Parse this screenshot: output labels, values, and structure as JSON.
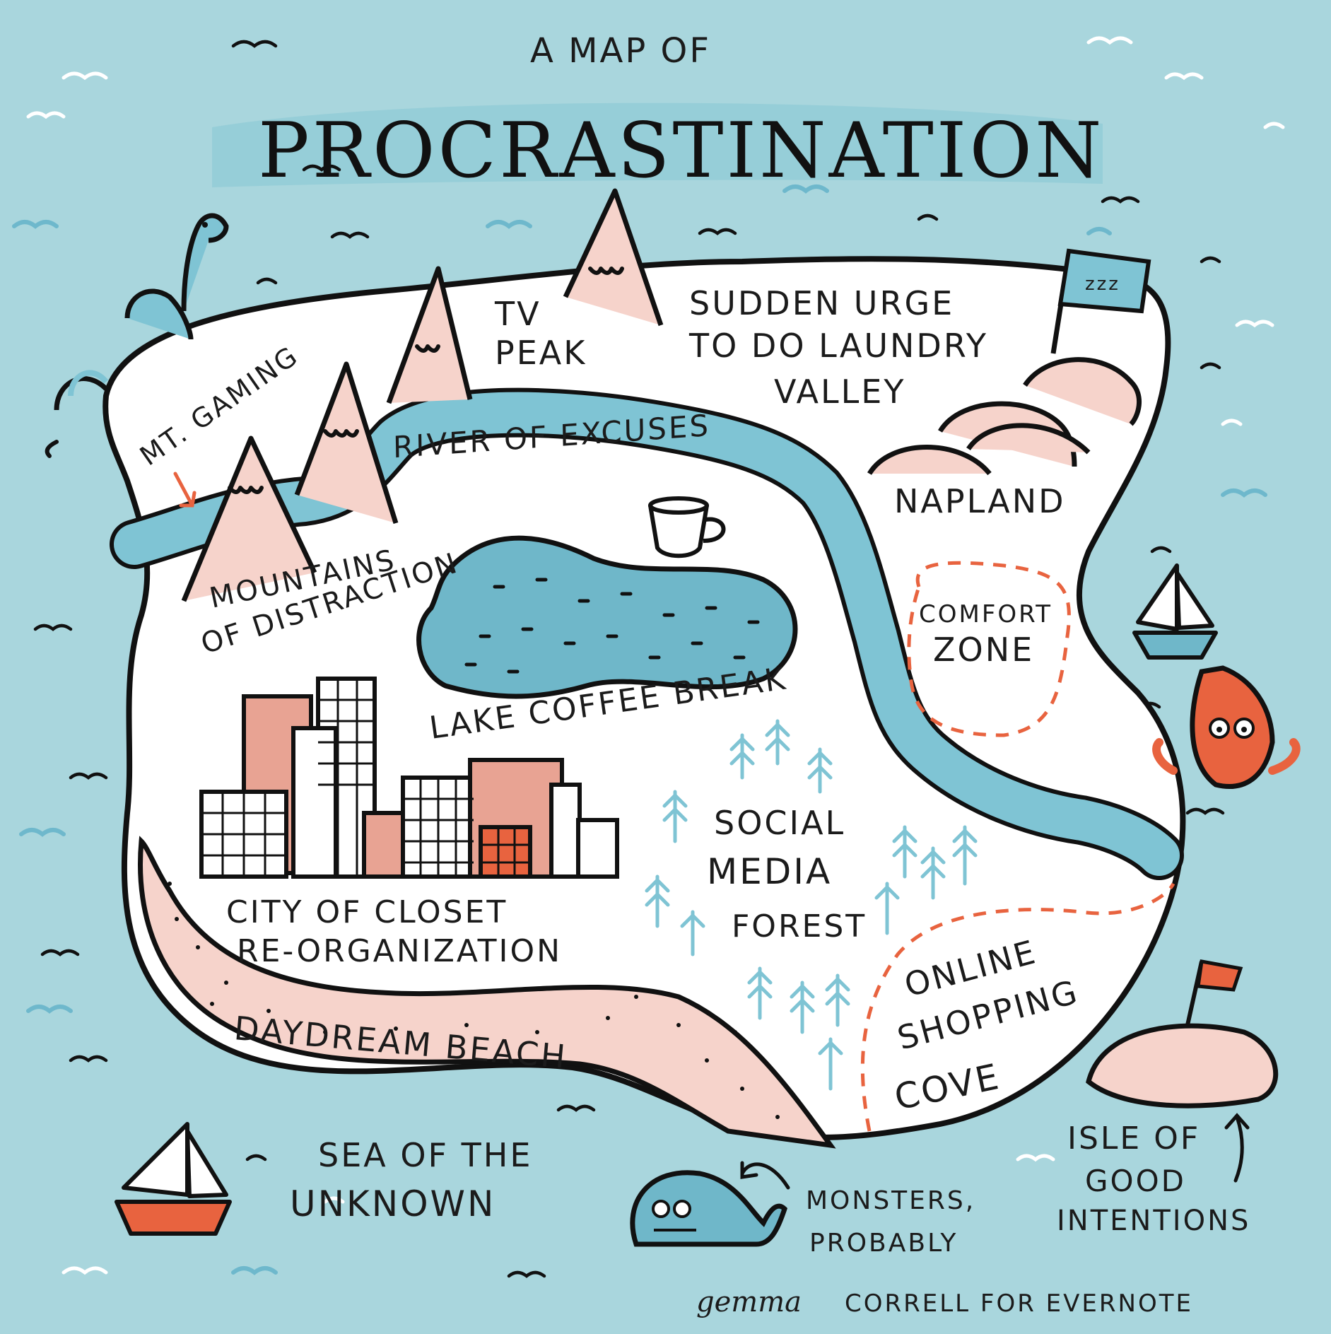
{
  "title": {
    "line1": "A MAP OF",
    "line2": "PROCRASTINATION"
  },
  "places": {
    "mt_gaming": "MT. GAMING",
    "tv_peak_1": "TV",
    "tv_peak_2": "PEAK",
    "laundry_1": "SUDDEN URGE",
    "laundry_2": "TO DO LAUNDRY",
    "laundry_3": "VALLEY",
    "river": "RIVER OF EXCUSES",
    "napland": "NAPLAND",
    "comfort_1": "COMFORT",
    "comfort_2": "ZONE",
    "mountains_1": "MOUNTAINS",
    "mountains_2": "OF DISTRACTION",
    "lake": "LAKE COFFEE BREAK",
    "city_1": "CITY OF CLOSET",
    "city_2": "RE-ORGANIZATION",
    "social_1": "SOCIAL",
    "social_2": "MEDIA",
    "social_3": "FOREST",
    "shopping_1": "ONLINE",
    "shopping_2": "SHOPPING",
    "shopping_3": "COVE",
    "beach": "DAYDREAM BEACH",
    "sea_1": "SEA OF THE",
    "sea_2": "UNKNOWN",
    "monsters_1": "MONSTERS,",
    "monsters_2": "PROBABLY",
    "isle_1": "ISLE OF",
    "isle_2": "GOOD",
    "isle_3": "INTENTIONS",
    "flag_zzz": "zzz"
  },
  "credit": {
    "author": "gemma",
    "rest": "CORRELL FOR EVERNOTE"
  },
  "colors": {
    "sea": "#a9d6dd",
    "land": "#ffffff",
    "river": "#7fc4d4",
    "pink": "#f6d3cb",
    "orange": "#e8633f",
    "ink": "#111111"
  },
  "icons": [
    "sea-serpent-icon",
    "coffee-cup-icon",
    "sailboat-icon",
    "squid-monster-icon",
    "whale-monster-icon",
    "flag-icon",
    "pine-tree-icon",
    "building-icon",
    "mountain-icon"
  ]
}
